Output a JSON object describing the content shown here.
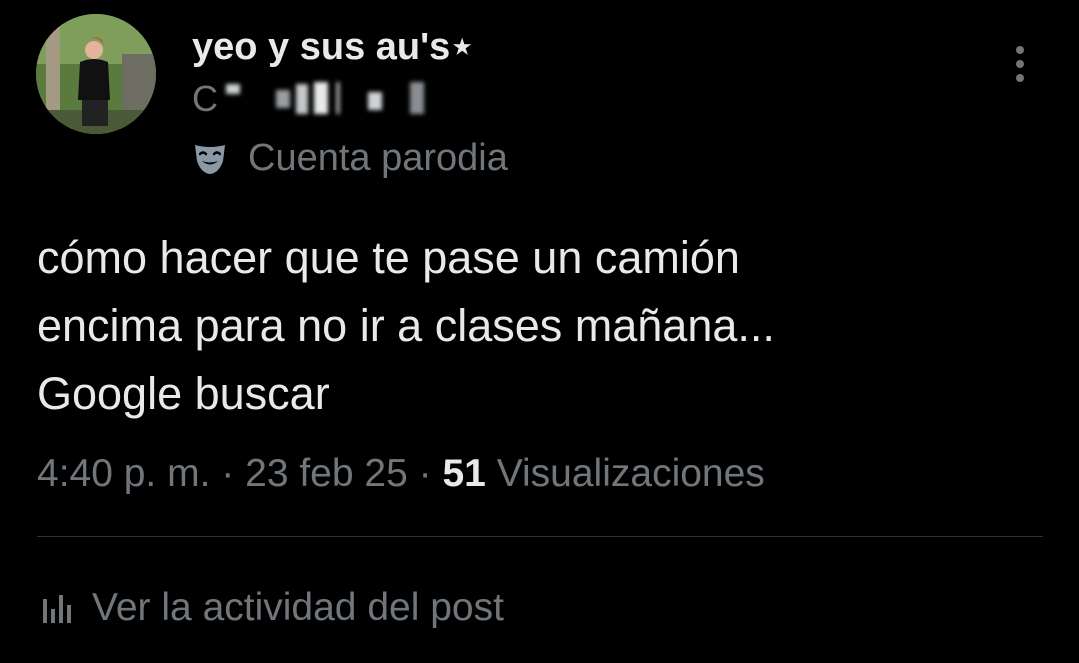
{
  "post": {
    "author": {
      "display_name": "yeo y sus au's⋆",
      "handle": "C",
      "badge_label": "Cuenta parodia",
      "badge_icon": "theater-mask-icon",
      "avatar_icon": "avatar-photo"
    },
    "menu_icon": "more-vertical-icon",
    "text_lines": [
      "cómo hacer que te pase un camión",
      "encima para no ir a clases mañana...",
      "Google buscar"
    ],
    "meta": {
      "time": "4:40 p. m.",
      "separator": "·",
      "date": "23 feb 25",
      "views_count": "51",
      "views_label": "Visualizaciones"
    },
    "activity": {
      "label": "Ver la actividad del post",
      "icon": "analytics-icon"
    }
  },
  "colors": {
    "background": "#000000",
    "primary_text": "#e7e9ea",
    "secondary_text": "#71767b",
    "divider": "#2f3336"
  }
}
